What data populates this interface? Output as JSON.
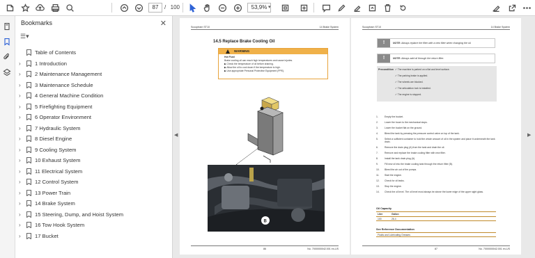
{
  "toolbar": {
    "current_page": "87",
    "page_separator": "/",
    "total_pages": "100",
    "zoom": "53,9%",
    "zoom_caret": "▾"
  },
  "bookmarks_panel": {
    "title": "Bookmarks",
    "close": "✕",
    "options_glyph": "☰▾",
    "items": [
      {
        "label": "Table of Contents",
        "expandable": false
      },
      {
        "label": "1 Introduction",
        "expandable": true
      },
      {
        "label": "2 Maintenance Management",
        "expandable": true
      },
      {
        "label": "3 Maintenance Schedule",
        "expandable": true
      },
      {
        "label": "4 General Machine Condition",
        "expandable": true
      },
      {
        "label": "5 Firefighting Equipment",
        "expandable": true
      },
      {
        "label": "6 Operator Environment",
        "expandable": true
      },
      {
        "label": "7 Hydraulic System",
        "expandable": true
      },
      {
        "label": "8 Diesel Engine",
        "expandable": true
      },
      {
        "label": "9 Cooling System",
        "expandable": true
      },
      {
        "label": "10 Exhaust System",
        "expandable": true
      },
      {
        "label": "11 Electrical System",
        "expandable": true
      },
      {
        "label": "12 Control System",
        "expandable": true
      },
      {
        "label": "13 Power Train",
        "expandable": true
      },
      {
        "label": "14 Brake System",
        "expandable": true
      },
      {
        "label": "15 Steering, Dump, and Hoist System",
        "expandable": true
      },
      {
        "label": "16 Tow Hook System",
        "expandable": true
      },
      {
        "label": "17 Bucket",
        "expandable": true
      }
    ]
  },
  "left_page": {
    "header_left": "Scooptram ST10",
    "header_right": "14 Brake System",
    "section_title": "14.5  Replace Brake Cooling Oil",
    "warning_label": "WARNING",
    "warning_heading": "Hot Fluid",
    "warning_lines": [
      "Brake cooling oil can reach high temperatures and cause injuries.",
      "▶ Check the temperature of oil before draining.",
      "▶ Allow the oil to cool down if the temperature is high.",
      "▶ Use appropriate Personal Protective Equipment (PPE)."
    ],
    "callout_a": "A",
    "callout_b": "B",
    "footer_left": "86",
    "footer_right": "No. 7000000042.001 en-US"
  },
  "right_page": {
    "header_left": "Scooptram ST10",
    "header_right": "14 Brake System",
    "note_icon": "!",
    "note_label": "NOTE:",
    "notes": [
      "Always replace the filter with a new filter when changing the oil.",
      "Always add oil through the return filter."
    ],
    "prereq_label": "Precondition",
    "prereqs": [
      "✓  The machine is parked on a flat and level surface.",
      "✓  The parking brake is applied.",
      "✓  The wheels are blocked.",
      "✓  The articulation lock is installed.",
      "✓  The engine is stopped."
    ],
    "steps": [
      {
        "num": "1.",
        "text": "Empty the bucket."
      },
      {
        "num": "2.",
        "text": "Lower the boom to the mechanical stops."
      },
      {
        "num": "3.",
        "text": "Lower the bucket flat on the ground."
      },
      {
        "num": "4.",
        "text": "Bleed the tank by pressing the pressure control valve on top of the tank."
      },
      {
        "num": "5.",
        "text": "Select a sufficient container to hold the whole amount of oil in the system and place it underneath the tank drain."
      },
      {
        "num": "6.",
        "text": "Remove the drain plug (A) from the tank and drain the oil."
      },
      {
        "num": "7.",
        "text": "Remove and replace the brake cooling filter with new filter."
      },
      {
        "num": "8.",
        "text": "Install the tank drain plug (A)."
      },
      {
        "num": "9.",
        "text": "Fill new oil into the brake cooling tank through the return filter (B)."
      },
      {
        "num": "10.",
        "text": "Bleed the air out of the pumps."
      },
      {
        "num": "11.",
        "text": "Start the engine."
      },
      {
        "num": "12.",
        "text": "Check for oil leaks."
      },
      {
        "num": "13.",
        "text": "Stop the engine."
      },
      {
        "num": "14.",
        "text": "Check the oil level. The oil level must always be above the lower edge of the upper sight glass."
      }
    ],
    "oil_capacity_title": "Oil Capacity",
    "oil_col1": "Liter",
    "oil_col2": "Gallon",
    "oil_val1": "100",
    "oil_val2": "26.4",
    "see_also_title": "See Reference Documentation",
    "see_also_item": "Fluids and Lubricating Greases",
    "footer_left": "87",
    "footer_right": "No. 7000000042.001 en-US"
  },
  "colors": {
    "warning": "#f0b149",
    "accent": "#3b6fd4"
  }
}
